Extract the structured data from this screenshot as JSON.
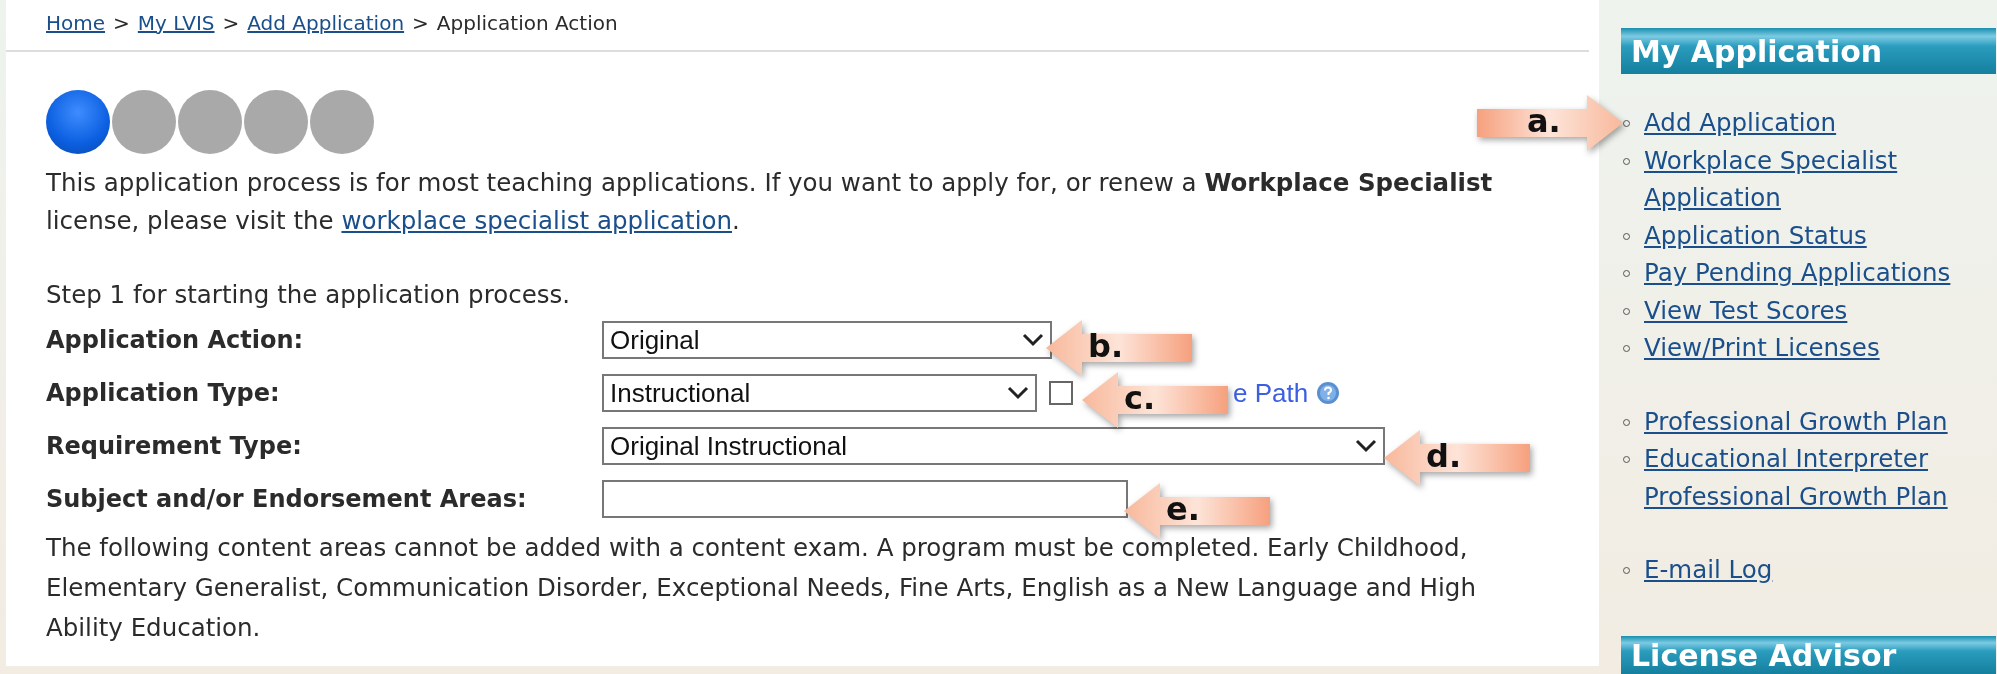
{
  "breadcrumb": [
    {
      "text": "Home",
      "link": true
    },
    {
      "text": ">",
      "link": false
    },
    {
      "text": "My LVIS",
      "link": true
    },
    {
      "text": ">",
      "link": false
    },
    {
      "text": "Add Application",
      "link": true
    },
    {
      "text": ">",
      "link": false
    },
    {
      "text": "Application Action",
      "link": false
    }
  ],
  "steps": [
    {
      "selected": true
    },
    {
      "selected": false
    },
    {
      "selected": false
    },
    {
      "selected": false
    },
    {
      "selected": false
    }
  ],
  "intro": {
    "text": "This application process is for most teaching applications. If you want to apply for, or renew a **Workplace Specialist** license, please visit the ",
    "link": "workplace specialist application",
    "end": "."
  },
  "step_note": "Step 1 for starting the application process.",
  "fields": [
    {
      "label": "Application Action:",
      "kind": "select",
      "value": "Original"
    },
    {
      "label": "Application Type:",
      "kind": "select",
      "value": "Instructional",
      "extra": {
        "checked": false,
        "label": "e Path"
      }
    },
    {
      "label": "Requirement Type:",
      "kind": "select",
      "value": "Original Instructional"
    },
    {
      "label": "Subject and/or Endorsement Areas:",
      "kind": "input"
    }
  ],
  "note": "The following content areas cannot be added with a content exam. A program must be completed. Early Childhood, Elementary Generalist, Communication Disorder, Exceptional Needs, Fine Arts, English as a New Language and High Ability Education.",
  "sidebar": {
    "title": "My Application",
    "groups": [
      [
        "Add Application",
        "Workplace Specialist Application",
        "Application Status",
        "Pay Pending Applications",
        "View Test Scores",
        "View/Print Licenses"
      ],
      [
        "Professional Growth Plan",
        "Educational Interpreter Professional Growth Plan"
      ],
      [
        "E-mail Log"
      ]
    ],
    "next_title": "License Advisor"
  },
  "callouts": [
    {
      "label": "a.",
      "kind": "right"
    },
    {
      "label": "b.",
      "kind": "left"
    },
    {
      "label": "c.",
      "kind": "left"
    },
    {
      "label": "d.",
      "kind": "left"
    },
    {
      "label": "e.",
      "kind": "left"
    }
  ]
}
